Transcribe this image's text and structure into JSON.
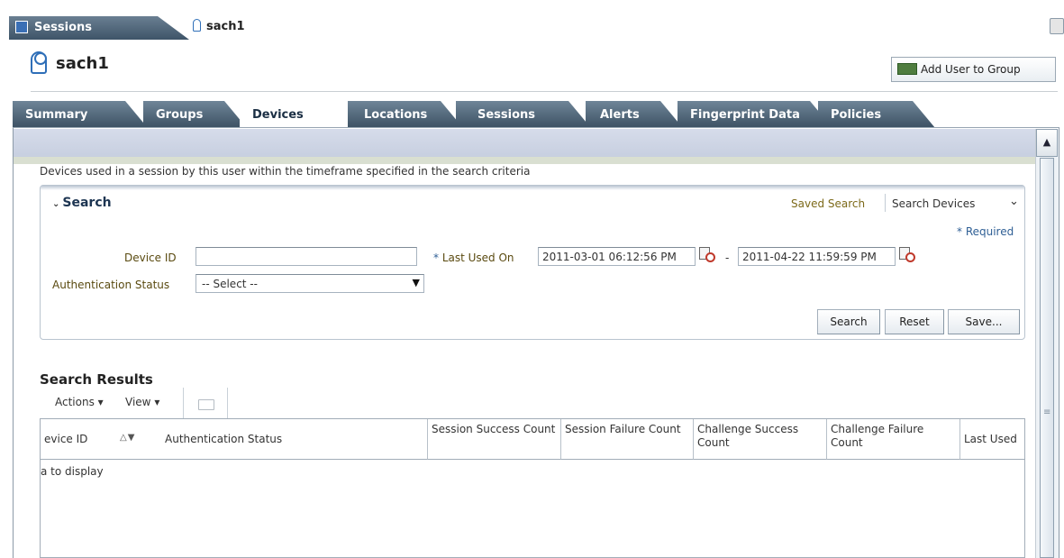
{
  "doc_tabs": {
    "active": "Sessions",
    "user": "sach1"
  },
  "header": {
    "title": "sach1",
    "add_button": "Add User to Group"
  },
  "tabs": [
    "Summary",
    "Groups",
    "Devices",
    "Locations",
    "Sessions",
    "Alerts",
    "Fingerprint Data",
    "Policies"
  ],
  "active_tab": "Devices",
  "description": "Devices used in a session by this user within the timeframe specified in the search criteria",
  "search": {
    "title": "Search",
    "saved_search_label": "Saved Search",
    "saved_search_value": "Search Devices",
    "required_note": "* Required",
    "device_id_label": "Device ID",
    "device_id_value": "",
    "auth_status_label": "Authentication Status",
    "auth_status_value": "-- Select --",
    "last_used_label": "Last Used On",
    "required_star": "*",
    "date_from": "2011-03-01 06:12:56 PM",
    "date_sep": "-",
    "date_to": "2011-04-22 11:59:59 PM",
    "buttons": {
      "search": "Search",
      "reset": "Reset",
      "save": "Save..."
    }
  },
  "results": {
    "title": "Search Results",
    "actions_label": "Actions",
    "view_label": "View",
    "columns": [
      "evice ID",
      "Authentication Status",
      "Session Success Count",
      "Session Failure Count",
      "Challenge Success Count",
      "Challenge Failure Count",
      "Last Used"
    ],
    "empty_text": "a to display"
  }
}
